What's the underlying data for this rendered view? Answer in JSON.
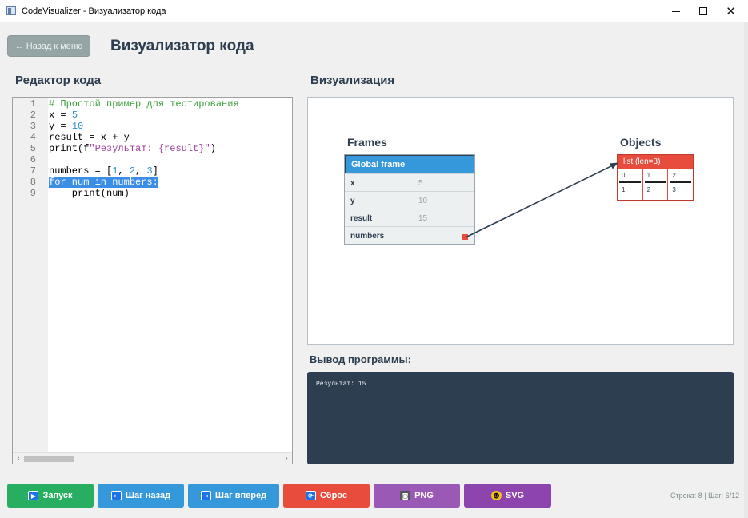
{
  "window": {
    "title": "CodeVisualizer - Визуализатор кода",
    "min_icon": "minimize-icon",
    "max_icon": "maximize-icon",
    "close_icon": "close-icon",
    "close_glyph": "✕"
  },
  "header": {
    "back_label": "← Назад к меню",
    "title": "Визуализатор кода"
  },
  "editor": {
    "label": "Редактор кода",
    "lines": [
      {
        "n": "1",
        "text": "# Простой пример для тестирования"
      },
      {
        "n": "2",
        "text": "x = 5"
      },
      {
        "n": "3",
        "text": "y = 10"
      },
      {
        "n": "4",
        "text": "result = x + y"
      },
      {
        "n": "5",
        "text": "print(f\"Результат: {result}\")"
      },
      {
        "n": "6",
        "text": ""
      },
      {
        "n": "7",
        "text": "numbers = [1, 2, 3]"
      },
      {
        "n": "8",
        "text": "for num in numbers:"
      },
      {
        "n": "9",
        "text": "    print(num)"
      }
    ],
    "current_line": 8,
    "scroll_left": "‹",
    "scroll_right": "›"
  },
  "visualization": {
    "label": "Визуализация",
    "frames_title": "Frames",
    "objects_title": "Objects",
    "global_frame": {
      "title": "Global frame",
      "vars": [
        {
          "name": "x",
          "value": "5"
        },
        {
          "name": "y",
          "value": "10"
        },
        {
          "name": "result",
          "value": "15"
        },
        {
          "name": "numbers",
          "value": ""
        }
      ]
    },
    "list_object": {
      "title": "list (len=3)",
      "items": [
        {
          "index": "0",
          "value": "1"
        },
        {
          "index": "1",
          "value": "2"
        },
        {
          "index": "2",
          "value": "3"
        }
      ]
    },
    "colors": {
      "frame_header": "#3498db",
      "list_header": "#e74c3c",
      "pointer": "#e74c3c",
      "arrow": "#2c3e50"
    }
  },
  "output": {
    "label": "Вывод программы:",
    "text": "Результат: 15"
  },
  "toolbar": {
    "run": {
      "label": "Запуск",
      "icon": "play-icon",
      "glyph": "▶"
    },
    "back": {
      "label": "Шаг назад",
      "icon": "arrow-left-icon",
      "glyph": "←"
    },
    "forward": {
      "label": "Шаг вперед",
      "icon": "arrow-right-icon",
      "glyph": "→"
    },
    "reset": {
      "label": "Сброс",
      "icon": "refresh-icon",
      "glyph": "⟳"
    },
    "png": {
      "label": "PNG",
      "icon": "camera-icon",
      "glyph": "◙"
    },
    "svg": {
      "label": "SVG",
      "icon": "palette-icon",
      "glyph": "☻"
    },
    "colors": {
      "run": "#27ae60",
      "step": "#3498db",
      "reset": "#e74c3c",
      "png": "#9b59b6",
      "svg": "#8e44ad"
    }
  },
  "status": {
    "text": "Строка: 8 | Шаг: 6/12"
  }
}
